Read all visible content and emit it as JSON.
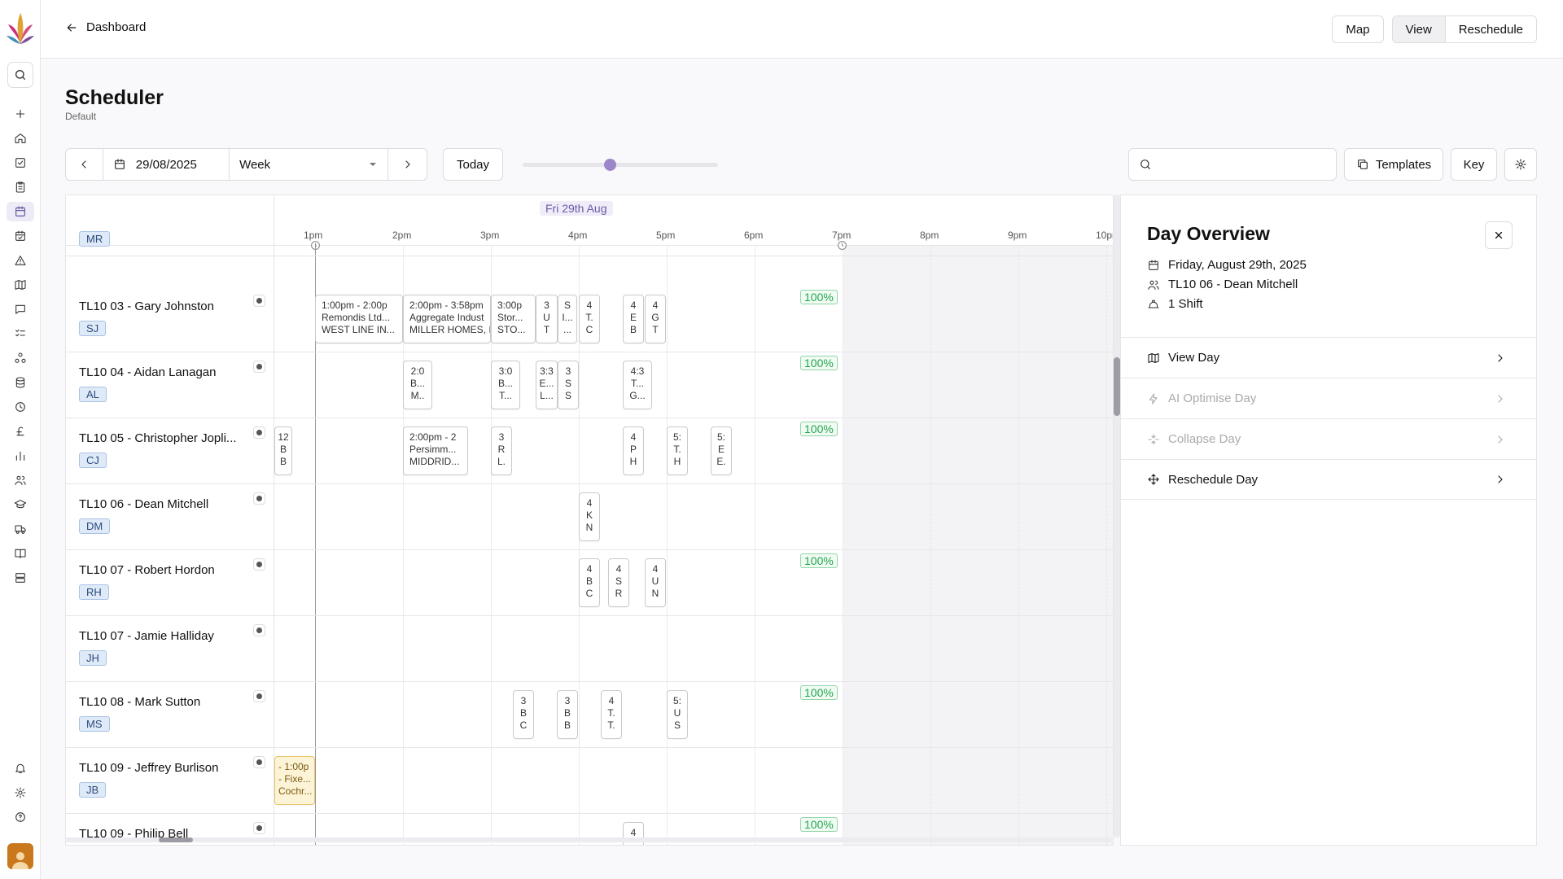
{
  "topbar": {
    "back_label": "Dashboard",
    "map_label": "Map",
    "view_label": "View",
    "reschedule_label": "Reschedule"
  },
  "page": {
    "title": "Scheduler",
    "subtitle": "Default"
  },
  "controls": {
    "date": "29/08/2025",
    "range": "Week",
    "today_label": "Today",
    "templates_label": "Templates",
    "key_label": "Key"
  },
  "grid": {
    "day_label": "Fri 29th Aug",
    "hours": [
      "1pm",
      "2pm",
      "3pm",
      "4pm",
      "5pm",
      "6pm",
      "7pm",
      "8pm",
      "9pm",
      "10pm"
    ],
    "rows": [
      {
        "name": "",
        "initials": "MR"
      },
      {
        "name": "TL10 03 - Gary Johnston",
        "initials": "SJ",
        "pct": "100%"
      },
      {
        "name": "TL10 04 - Aidan Lanagan",
        "initials": "AL",
        "pct": "100%"
      },
      {
        "name": "TL10 05 - Christopher Jopli...",
        "initials": "CJ",
        "pct": "100%"
      },
      {
        "name": "TL10 06 - Dean Mitchell",
        "initials": "DM"
      },
      {
        "name": "TL10 07 - Robert Hordon",
        "initials": "RH",
        "pct": "100%"
      },
      {
        "name": "TL10 07 - Jamie Halliday",
        "initials": "JH"
      },
      {
        "name": "TL10 08 - Mark Sutton",
        "initials": "MS",
        "pct": "100%"
      },
      {
        "name": "TL10 09 - Jeffrey Burlison",
        "initials": "JB"
      },
      {
        "name": "TL10 09 - Philip Bell",
        "initials": "",
        "pct": "100%"
      }
    ],
    "jobs": {
      "r1": [
        [
          "1:00pm - 2:00p",
          "Remondis Ltd...",
          "WEST LINE IN..."
        ],
        [
          "2:00pm - 3:58pm",
          "Aggregate Indust",
          "MILLER HOMES, I"
        ],
        [
          "3:00p",
          "Stor...",
          "STO..."
        ],
        [
          "3",
          "U",
          "T"
        ],
        [
          "S",
          "I...",
          "..."
        ],
        [
          "4",
          "T.",
          "C"
        ],
        [
          "4",
          "E",
          "B"
        ],
        [
          "4",
          "G",
          "T"
        ]
      ],
      "r2": [
        [
          "2:0",
          "B...",
          "M.."
        ],
        [
          "3:0",
          "B...",
          "T..."
        ],
        [
          "3:3",
          "E...",
          "L..."
        ],
        [
          "3",
          "S",
          "S"
        ],
        [
          "4:3",
          "T...",
          "G..."
        ]
      ],
      "r3": [
        [
          "12",
          "B",
          "B"
        ],
        [
          "2:00pm - 2",
          "Persimm...",
          "MIDDRID..."
        ],
        [
          "3",
          "R",
          "L."
        ],
        [
          "4",
          "P",
          "H"
        ],
        [
          "5:",
          "T.",
          "H"
        ],
        [
          "5:",
          "E",
          "E."
        ]
      ],
      "r4": [
        [
          "4",
          "K",
          "N"
        ]
      ],
      "r5": [
        [
          "4",
          "B",
          "C"
        ],
        [
          "4",
          "S",
          "R"
        ],
        [
          "4",
          "U",
          "N"
        ]
      ],
      "r7": [
        [
          "3",
          "B",
          "C"
        ],
        [
          "3",
          "B",
          "B"
        ],
        [
          "4",
          "T.",
          "T."
        ],
        [
          "5:",
          "U",
          "S"
        ]
      ],
      "r8": [
        [
          "- 1:00p",
          "- Fixe...",
          "Cochr..."
        ]
      ],
      "r9": [
        [
          "4",
          "",
          ""
        ]
      ]
    }
  },
  "panel": {
    "title": "Day Overview",
    "date": "Friday, August 29th, 2025",
    "resource": "TL10 06 - Dean Mitchell",
    "shifts": "1 Shift",
    "actions": [
      "View Day",
      "AI Optimise Day",
      "Collapse Day",
      "Reschedule Day"
    ]
  },
  "colors": {
    "accent": "#6d5aa8",
    "success": "#1ea84a",
    "warning_job": "#fdf3d6"
  }
}
